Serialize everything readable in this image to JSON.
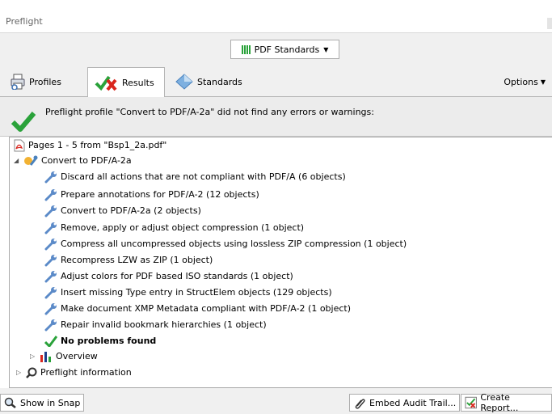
{
  "window": {
    "title": "Preflight"
  },
  "toolbar": {
    "standards_dropdown": "PDF Standards"
  },
  "tabs": [
    {
      "label": "Profiles",
      "icon": "printer-icon"
    },
    {
      "label": "Results",
      "icon": "results-icon"
    },
    {
      "label": "Standards",
      "icon": "standards-icon"
    }
  ],
  "options_label": "Options",
  "summary": {
    "message": "Preflight profile \"Convert to PDF/A-2a\" did not find any errors or warnings:"
  },
  "tree": {
    "document": "Pages 1 - 5 from \"Bsp1_2a.pdf\"",
    "profile": "Convert to PDF/A-2a",
    "fixups": [
      "Discard all actions that are not compliant with PDF/A (6 objects)",
      "Prepare annotations for PDF/A-2 (12 objects)",
      "Convert to PDF/A-2a (2 objects)",
      "Remove, apply or adjust object compression (1 object)",
      "Compress all uncompressed objects using lossless ZIP compression (1 object)",
      "Recompress LZW as ZIP (1 object)",
      "Adjust colors for PDF based ISO standards (1 object)",
      "Insert missing Type entry in StructElem objects (129 objects)",
      "Make document XMP Metadata compliant with PDF/A-2 (1 object)",
      "Repair invalid bookmark hierarchies (1 object)"
    ],
    "no_problems": "No problems found",
    "overview": "Overview",
    "preflight_info": "Preflight information"
  },
  "bottom": {
    "show_in_snap": "Show in Snap",
    "embed_audit": "Embed Audit Trail...",
    "create_report": "Create Report..."
  },
  "colors": {
    "accent_green": "#2aa23a",
    "error_red": "#d9251d",
    "panel_bg": "#f0f0f0"
  }
}
